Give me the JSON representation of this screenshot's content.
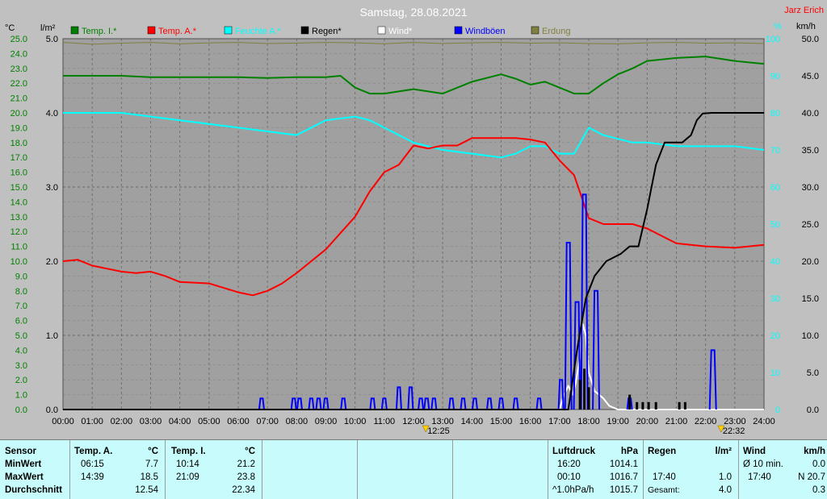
{
  "title": "Samstag, 28.08.2021",
  "author": "Jarz Erich",
  "legend": [
    {
      "label": "Temp. I.*",
      "color": "#008000"
    },
    {
      "label": "Temp. A.*",
      "color": "#ff0000"
    },
    {
      "label": "Feuchte A.*",
      "color": "#00ffff"
    },
    {
      "label": "Regen*",
      "color": "#000000"
    },
    {
      "label": "Wind*",
      "color": "#ffffff"
    },
    {
      "label": "Windböen",
      "color": "#0000ff"
    },
    {
      "label": "Erdung",
      "color": "#808040"
    }
  ],
  "axis_units": {
    "temp": "°C",
    "rain": "l/m²",
    "humidity": "%",
    "wind": "km/h"
  },
  "markers": [
    {
      "label": "12:25",
      "hour": 12.42
    },
    {
      "label": "22:32",
      "hour": 22.53
    }
  ],
  "chart_data": {
    "type": "line",
    "x_range": [
      0,
      24
    ],
    "x_ticks": [
      "00:00",
      "01:00",
      "02:00",
      "03:00",
      "04:00",
      "05:00",
      "06:00",
      "07:00",
      "08:00",
      "09:00",
      "10:00",
      "11:00",
      "12:00",
      "13:00",
      "14:00",
      "15:00",
      "16:00",
      "17:00",
      "18:00",
      "19:00",
      "20:00",
      "21:00",
      "22:00",
      "23:00",
      "24:00"
    ],
    "axes": {
      "temp": {
        "range": [
          0,
          25
        ],
        "step": 1,
        "label": "°C"
      },
      "rain": {
        "range": [
          0,
          5
        ],
        "step": 1,
        "label": "l/m²"
      },
      "humidity": {
        "range": [
          0,
          100
        ],
        "step": 10,
        "label": "%"
      },
      "wind": {
        "range": [
          0,
          50
        ],
        "step": 5,
        "label": "km/h"
      }
    },
    "grid": true,
    "series": [
      {
        "name": "Temp. I.*",
        "axis": "temp",
        "color": "#008000",
        "x": [
          0,
          1,
          2,
          3,
          4,
          5,
          6,
          7,
          8,
          9,
          9.5,
          10,
          10.5,
          11,
          12,
          13,
          14,
          15,
          15.5,
          16,
          16.5,
          17,
          17.5,
          18,
          18.5,
          19,
          19.5,
          20,
          21,
          22,
          23,
          24
        ],
        "y": [
          22.5,
          22.5,
          22.5,
          22.4,
          22.4,
          22.4,
          22.4,
          22.35,
          22.4,
          22.4,
          22.5,
          21.7,
          21.3,
          21.3,
          21.6,
          21.3,
          22.1,
          22.6,
          22.3,
          21.9,
          22.1,
          21.7,
          21.3,
          21.3,
          22.0,
          22.6,
          23.0,
          23.5,
          23.7,
          23.8,
          23.5,
          23.3
        ]
      },
      {
        "name": "Temp. A.*",
        "axis": "temp",
        "color": "#ff0000",
        "x": [
          0,
          0.5,
          1,
          2,
          2.5,
          3,
          3.5,
          4,
          5,
          6,
          6.5,
          7,
          7.5,
          8,
          9,
          10,
          10.5,
          11,
          11.5,
          12,
          12.5,
          13,
          13.5,
          14,
          15,
          15.5,
          16,
          16.5,
          17,
          17.5,
          18,
          18.5,
          19,
          19.5,
          20,
          21,
          22,
          23,
          24
        ],
        "y": [
          10.0,
          10.1,
          9.7,
          9.3,
          9.2,
          9.3,
          9.0,
          8.6,
          8.5,
          7.9,
          7.7,
          8.0,
          8.5,
          9.2,
          10.8,
          13.0,
          14.7,
          16.0,
          16.5,
          17.8,
          17.6,
          17.8,
          17.8,
          18.3,
          18.3,
          18.3,
          18.2,
          18.0,
          16.8,
          15.8,
          12.9,
          12.5,
          12.5,
          12.5,
          12.2,
          11.2,
          11.0,
          10.9,
          11.1
        ]
      },
      {
        "name": "Feuchte A.*",
        "axis": "humidity",
        "color": "#00ffff",
        "x": [
          0,
          1,
          2,
          3,
          4,
          5,
          6,
          7,
          8,
          8.5,
          9,
          10,
          10.5,
          11,
          12,
          13,
          14,
          15,
          15.5,
          16,
          16.5,
          17,
          17.5,
          18,
          18.5,
          19,
          19.5,
          20,
          21,
          22,
          23,
          24
        ],
        "y": [
          80,
          80,
          80,
          79,
          78,
          77,
          76,
          75,
          74,
          76,
          78,
          79,
          78,
          76,
          72,
          70,
          69,
          68,
          69,
          71,
          71,
          69,
          69,
          76,
          74,
          73,
          72,
          72,
          71,
          71,
          71,
          70
        ]
      },
      {
        "name": "Regen*",
        "axis": "rain",
        "color": "#000000",
        "x": [
          0,
          17.3,
          17.6,
          17.9,
          18.2,
          18.6,
          19.1,
          19.4,
          19.7,
          20.0,
          20.3,
          20.6,
          20.9,
          21.2,
          21.5,
          21.7,
          21.9,
          22.2,
          22.5,
          23,
          24
        ],
        "y": [
          0,
          0,
          0.8,
          1.5,
          1.8,
          2.0,
          2.1,
          2.2,
          2.2,
          2.7,
          3.3,
          3.6,
          3.6,
          3.6,
          3.7,
          3.9,
          3.99,
          4.0,
          4.0,
          4.0,
          4.0
        ]
      },
      {
        "name": "Wind*",
        "axis": "wind",
        "color": "#ffffff",
        "x": [
          0,
          17.0,
          17.15,
          17.3,
          17.45,
          17.55,
          17.7,
          17.8,
          17.9,
          18.0,
          18.2,
          18.5,
          18.7,
          19.0,
          24
        ],
        "y": [
          0,
          0,
          2.0,
          3.2,
          2.0,
          3.5,
          7.0,
          11.5,
          10.0,
          5.0,
          2.5,
          1.5,
          0.5,
          0,
          0
        ]
      },
      {
        "name": "Windböen",
        "axis": "wind",
        "color": "#0000ff",
        "gusts": [
          {
            "x": 6.8,
            "v": 1.5
          },
          {
            "x": 7.9,
            "v": 1.5
          },
          {
            "x": 8.1,
            "v": 1.5
          },
          {
            "x": 8.5,
            "v": 1.5
          },
          {
            "x": 8.75,
            "v": 1.5
          },
          {
            "x": 9.0,
            "v": 1.5
          },
          {
            "x": 9.6,
            "v": 1.5
          },
          {
            "x": 10.6,
            "v": 1.5
          },
          {
            "x": 11.0,
            "v": 1.5
          },
          {
            "x": 11.5,
            "v": 3.0
          },
          {
            "x": 11.9,
            "v": 3.0
          },
          {
            "x": 12.25,
            "v": 1.5
          },
          {
            "x": 12.45,
            "v": 1.5
          },
          {
            "x": 12.7,
            "v": 1.5
          },
          {
            "x": 13.3,
            "v": 1.5
          },
          {
            "x": 13.7,
            "v": 1.5
          },
          {
            "x": 14.1,
            "v": 1.5
          },
          {
            "x": 14.6,
            "v": 1.5
          },
          {
            "x": 15.0,
            "v": 1.5
          },
          {
            "x": 15.5,
            "v": 1.5
          },
          {
            "x": 16.3,
            "v": 1.5
          },
          {
            "x": 17.05,
            "v": 4.0
          },
          {
            "x": 17.3,
            "v": 22.5
          },
          {
            "x": 17.6,
            "v": 14.5
          },
          {
            "x": 17.85,
            "v": 29.0
          },
          {
            "x": 18.25,
            "v": 16.0
          },
          {
            "x": 19.4,
            "v": 1.5
          },
          {
            "x": 22.25,
            "v": 8.0
          }
        ]
      },
      {
        "name": "Erdung",
        "axis": "humidity",
        "color": "#808040",
        "x": [
          0,
          1,
          2,
          3,
          4,
          5,
          6,
          7,
          8,
          9,
          10,
          11,
          12,
          13,
          14,
          15,
          16,
          17,
          18,
          19,
          20,
          21,
          22,
          23,
          24
        ],
        "y": [
          99,
          98.5,
          98.8,
          99,
          98.6,
          98.9,
          99,
          98.7,
          98.8,
          99,
          98.9,
          98.6,
          99,
          98.7,
          98.9,
          99,
          98.8,
          98.9,
          98.7,
          98.6,
          98.9,
          99,
          98.8,
          98.9,
          98.7
        ]
      }
    ]
  },
  "stats": {
    "temp_a": {
      "header": "Temp. A.",
      "unit": "°C",
      "min": {
        "time": "06:15",
        "value": "7.7"
      },
      "max": {
        "time": "14:39",
        "value": "18.5"
      },
      "avg": "12.54"
    },
    "temp_i": {
      "header": "Temp. I.",
      "unit": "°C",
      "min": {
        "time": "10:14",
        "value": "21.2"
      },
      "max": {
        "time": "21:09",
        "value": "23.8"
      },
      "avg": "22.34"
    },
    "row_labels": {
      "header": "Sensor",
      "min": "MinWert",
      "max": "MaxWert",
      "avg": "Durchschnitt"
    },
    "pressure": {
      "header": "Luftdruck",
      "unit": "hPa",
      "min": {
        "time": "16:20",
        "value": "1014.1"
      },
      "max": {
        "time": "00:10",
        "value": "1016.7"
      },
      "trend": {
        "label": "^1.0hPa/h",
        "value": "1015.7"
      }
    },
    "rain": {
      "header": "Regen",
      "unit": "l/m²",
      "max": {
        "time": "17:40",
        "value": "1.0"
      },
      "total": {
        "label": "Gesamt:",
        "value": "4.0"
      }
    },
    "wind": {
      "header": "Wind",
      "unit": "km/h",
      "min": {
        "label": "Ø 10 min.",
        "value": "0.0"
      },
      "max": {
        "time": "17:40",
        "value": "N 20.7"
      },
      "avg": {
        "value": "0.3"
      }
    }
  }
}
